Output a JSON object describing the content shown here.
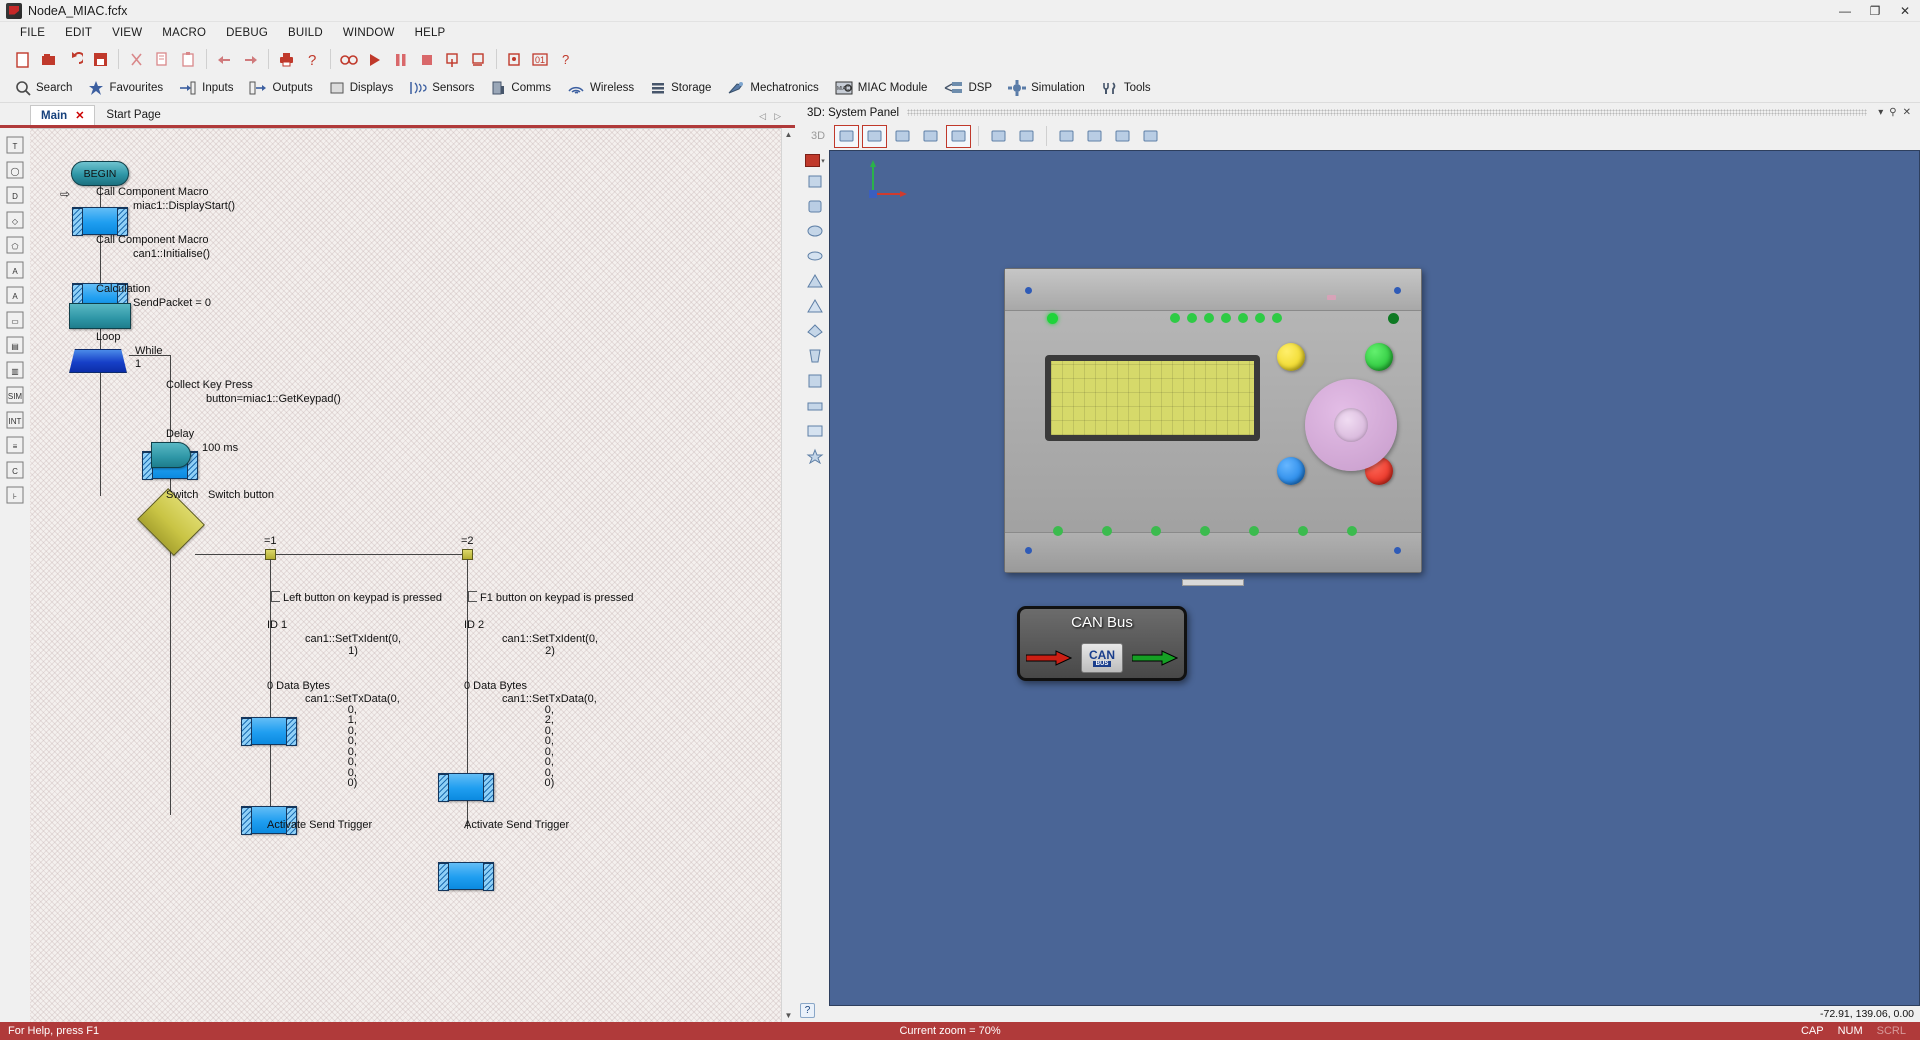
{
  "window": {
    "title": "NodeA_MIAC.fcfx",
    "minimize": "—",
    "maximize": "❐",
    "close": "✕"
  },
  "menu": [
    "FILE",
    "EDIT",
    "VIEW",
    "MACRO",
    "DEBUG",
    "BUILD",
    "WINDOW",
    "HELP"
  ],
  "toolbar": [
    "new-icon",
    "open-icon",
    "undo-icon",
    "save-icon",
    "sep",
    "cut-icon",
    "copy-icon",
    "paste-icon",
    "sep",
    "undo-arrow-icon",
    "redo-arrow-icon",
    "sep",
    "print-icon",
    "help-icon",
    "sep",
    "glasses-icon",
    "run-icon",
    "pause-icon",
    "stop-icon",
    "step-into-icon",
    "step-over-icon",
    "sep",
    "call-icon",
    "counter-icon",
    "question-icon"
  ],
  "ribbon": [
    {
      "label": "Search",
      "icon": "search-icon"
    },
    {
      "label": "Favourites",
      "icon": "star-icon"
    },
    {
      "label": "Inputs",
      "icon": "inputs-icon"
    },
    {
      "label": "Outputs",
      "icon": "outputs-icon"
    },
    {
      "label": "Displays",
      "icon": "displays-icon"
    },
    {
      "label": "Sensors",
      "icon": "sensors-icon"
    },
    {
      "label": "Comms",
      "icon": "comms-icon"
    },
    {
      "label": "Wireless",
      "icon": "wireless-icon"
    },
    {
      "label": "Storage",
      "icon": "storage-icon"
    },
    {
      "label": "Mechatronics",
      "icon": "mechatronics-icon"
    },
    {
      "label": "MIAC Module",
      "icon": "miac-module-icon"
    },
    {
      "label": "DSP",
      "icon": "dsp-icon"
    },
    {
      "label": "Simulation",
      "icon": "simulation-icon"
    },
    {
      "label": "Tools",
      "icon": "tools-icon"
    }
  ],
  "tabs": [
    {
      "label": "Start Page",
      "active": false,
      "closable": false
    },
    {
      "label": "Main",
      "active": true,
      "closable": true,
      "close": "✕"
    }
  ],
  "tab_nav": {
    "prev": "◁",
    "next": "▷"
  },
  "tool_palette": [
    "text-tool",
    "ellipse-tool",
    "d-shape-tool",
    "diamond-tool",
    "polygon-tool",
    "text-a-tool",
    "font-tool",
    "rounded-tool",
    "panel-tool",
    "bar-tool",
    "sim-tool",
    "int-tool",
    "lines-tool",
    "c-tool",
    "connector-tool"
  ],
  "flowchart": {
    "begin": "BEGIN",
    "nodes": [
      {
        "type": "call-component-macro",
        "title": "Call Component Macro",
        "value": "miac1::DisplayStart()"
      },
      {
        "type": "call-component-macro",
        "title": "Call Component Macro",
        "value": "can1::Initialise()"
      },
      {
        "type": "calculation",
        "title": "Calculation",
        "value": "SendPacket = 0"
      },
      {
        "type": "loop",
        "title": "Loop",
        "cond_label": "While",
        "cond_value": "1"
      },
      {
        "type": "call-component-macro",
        "title": "Collect Key Press",
        "value": "button=miac1::GetKeypad()"
      },
      {
        "type": "delay",
        "title": "Delay",
        "value": "100 ms"
      },
      {
        "type": "switch",
        "title": "Switch",
        "value": "Switch button"
      }
    ],
    "branches": [
      {
        "case": "=1",
        "comment": "Left button on keypad is pressed",
        "steps": [
          {
            "title": "ID 1",
            "value": "can1::SetTxIdent(0,\n1)"
          },
          {
            "title": "0 Data Bytes",
            "value": "can1::SetTxData(0,\n0,\n1,\n0,\n0,\n0,\n0,\n0,\n0)"
          },
          {
            "title": "Activate Send Trigger",
            "value": ""
          }
        ]
      },
      {
        "case": "=2",
        "comment": "F1 button on keypad is pressed",
        "steps": [
          {
            "title": "ID 2",
            "value": "can1::SetTxIdent(0,\n2)"
          },
          {
            "title": "0 Data Bytes",
            "value": "can1::SetTxData(0,\n0,\n2,\n0,\n0,\n0,\n0,\n0,\n0)"
          },
          {
            "title": "Activate Send Trigger",
            "value": ""
          }
        ]
      }
    ]
  },
  "panel3d": {
    "title": "3D: System Panel",
    "dropdown": "▾",
    "pin": "📌",
    "close": "✕",
    "mode_label": "3D",
    "toolbar_icons": [
      "select-icon",
      "move-icon",
      "rotate-icon",
      "scale-icon",
      "snap-icon",
      "render-icon",
      "solid-icon",
      "wrench-icon",
      "components-icon",
      "camera-icon",
      "camera-dropdown-icon"
    ],
    "side_icons": [
      "color-swatch",
      "3d-toggle-icon",
      "cube-icon",
      "cylinder-icon",
      "sphere-icon",
      "ellipse-icon",
      "cone-icon",
      "pyramid-icon",
      "prism-icon",
      "box-icon",
      "plate-icon",
      "panel-icon",
      "star-icon"
    ],
    "coordinates": "-72.91, 139.06, 0.00",
    "can_bus_label": "CAN Bus",
    "chip_line1": "CAN",
    "chip_line2": "BUS"
  },
  "statusbar": {
    "help": "For Help, press F1",
    "zoom": "Current zoom = 70%",
    "indicators": [
      {
        "label": "CAP",
        "on": true
      },
      {
        "label": "NUM",
        "on": true
      },
      {
        "label": "SCRL",
        "on": false
      }
    ]
  },
  "help_button": "?",
  "colors": {
    "accent_red": "#b03a3a",
    "scene_blue": "#4a6596",
    "macro_blue": "#1f9ef0",
    "calc_teal": "#2e96a6",
    "loop_blue": "#1740c8",
    "switch_yellow": "#c9c445"
  }
}
